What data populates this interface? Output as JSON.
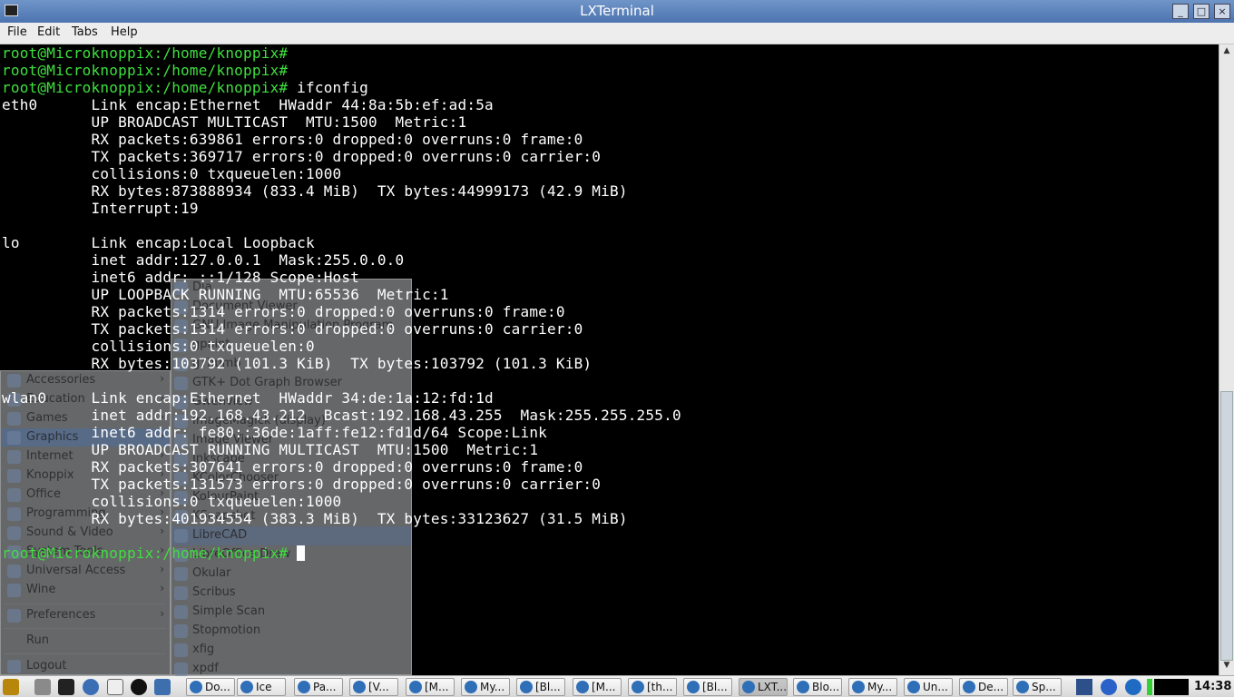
{
  "window": {
    "title": "LXTerminal",
    "btn_min": "_",
    "btn_max": "□",
    "btn_close": "×"
  },
  "menu": {
    "file": "File",
    "edit": "Edit",
    "tabs": "Tabs",
    "help": "Help"
  },
  "terminal": {
    "lines": [
      {
        "prompt": "root@Microknoppix:/home/knoppix#",
        "text": ""
      },
      {
        "prompt": "root@Microknoppix:/home/knoppix#",
        "text": ""
      },
      {
        "prompt": "root@Microknoppix:/home/knoppix#",
        "text": " ifconfig"
      },
      {
        "prompt": "",
        "text": "eth0      Link encap:Ethernet  HWaddr 44:8a:5b:ef:ad:5a"
      },
      {
        "prompt": "",
        "text": "          UP BROADCAST MULTICAST  MTU:1500  Metric:1"
      },
      {
        "prompt": "",
        "text": "          RX packets:639861 errors:0 dropped:0 overruns:0 frame:0"
      },
      {
        "prompt": "",
        "text": "          TX packets:369717 errors:0 dropped:0 overruns:0 carrier:0"
      },
      {
        "prompt": "",
        "text": "          collisions:0 txqueuelen:1000"
      },
      {
        "prompt": "",
        "text": "          RX bytes:873888934 (833.4 MiB)  TX bytes:44999173 (42.9 MiB)"
      },
      {
        "prompt": "",
        "text": "          Interrupt:19"
      },
      {
        "prompt": "",
        "text": ""
      },
      {
        "prompt": "",
        "text": "lo        Link encap:Local Loopback"
      },
      {
        "prompt": "",
        "text": "          inet addr:127.0.0.1  Mask:255.0.0.0"
      },
      {
        "prompt": "",
        "text": "          inet6 addr: ::1/128 Scope:Host"
      },
      {
        "prompt": "",
        "text": "          UP LOOPBACK RUNNING  MTU:65536  Metric:1"
      },
      {
        "prompt": "",
        "text": "          RX packets:1314 errors:0 dropped:0 overruns:0 frame:0"
      },
      {
        "prompt": "",
        "text": "          TX packets:1314 errors:0 dropped:0 overruns:0 carrier:0"
      },
      {
        "prompt": "",
        "text": "          collisions:0 txqueuelen:0"
      },
      {
        "prompt": "",
        "text": "          RX bytes:103792 (101.3 KiB)  TX bytes:103792 (101.3 KiB)"
      },
      {
        "prompt": "",
        "text": ""
      },
      {
        "prompt": "",
        "text": "wlan0     Link encap:Ethernet  HWaddr 34:de:1a:12:fd:1d"
      },
      {
        "prompt": "",
        "text": "          inet addr:192.168.43.212  Bcast:192.168.43.255  Mask:255.255.255.0"
      },
      {
        "prompt": "",
        "text": "          inet6 addr: fe80::36de:1aff:fe12:fd1d/64 Scope:Link"
      },
      {
        "prompt": "",
        "text": "          UP BROADCAST RUNNING MULTICAST  MTU:1500  Metric:1"
      },
      {
        "prompt": "",
        "text": "          RX packets:307641 errors:0 dropped:0 overruns:0 frame:0"
      },
      {
        "prompt": "",
        "text": "          TX packets:131573 errors:0 dropped:0 overruns:0 carrier:0"
      },
      {
        "prompt": "",
        "text": "          collisions:0 txqueuelen:1000"
      },
      {
        "prompt": "",
        "text": "          RX bytes:401934554 (383.3 MiB)  TX bytes:33123627 (31.5 MiB)"
      },
      {
        "prompt": "",
        "text": ""
      },
      {
        "prompt": "root@Microknoppix:/home/knoppix#",
        "text": " ",
        "cursor": true
      }
    ]
  },
  "start_menu": {
    "items": [
      {
        "label": "Accessories",
        "arrow": "›"
      },
      {
        "label": "Education",
        "arrow": "›"
      },
      {
        "label": "Games",
        "arrow": "›"
      },
      {
        "label": "Graphics",
        "arrow": "›"
      },
      {
        "label": "Internet",
        "arrow": "›"
      },
      {
        "label": "Knoppix",
        "arrow": "›"
      },
      {
        "label": "Office",
        "arrow": "›"
      },
      {
        "label": "Programming",
        "arrow": "›"
      },
      {
        "label": "Sound & Video",
        "arrow": "›"
      },
      {
        "label": "System Tools",
        "arrow": "›"
      },
      {
        "label": "Universal Access",
        "arrow": "›"
      },
      {
        "label": "Wine",
        "arrow": "›"
      }
    ],
    "preferences": {
      "label": "Preferences",
      "arrow": "›"
    },
    "run": "Run",
    "logout": "Logout"
  },
  "graphics_submenu": {
    "items": [
      "Dia",
      "Document Viewer",
      "GNU Image Manipulation Program",
      "gpaint",
      "gThumb",
      "GTK+ Dot Graph Browser",
      "Gwenview",
      "ImageMagick (display)",
      "Image Viewer",
      "Inkscape",
      "KColorChooser",
      "KolourPaint",
      "KSnapshot",
      "LibreCAD",
      "LibreOffice Draw",
      "Okular",
      "Scribus",
      "Simple Scan",
      "Stopmotion",
      "xfig",
      "xpdf"
    ]
  },
  "taskbar": {
    "tasks": [
      "Do...",
      "Ice",
      "Pa...",
      "[V...",
      "[M...",
      "My...",
      "[Bl...",
      "[M...",
      "[th...",
      "[Bl...",
      "LXT...",
      "Blo...",
      "My...",
      "Un...",
      "De...",
      "Sp..."
    ],
    "clock": "14:38"
  }
}
